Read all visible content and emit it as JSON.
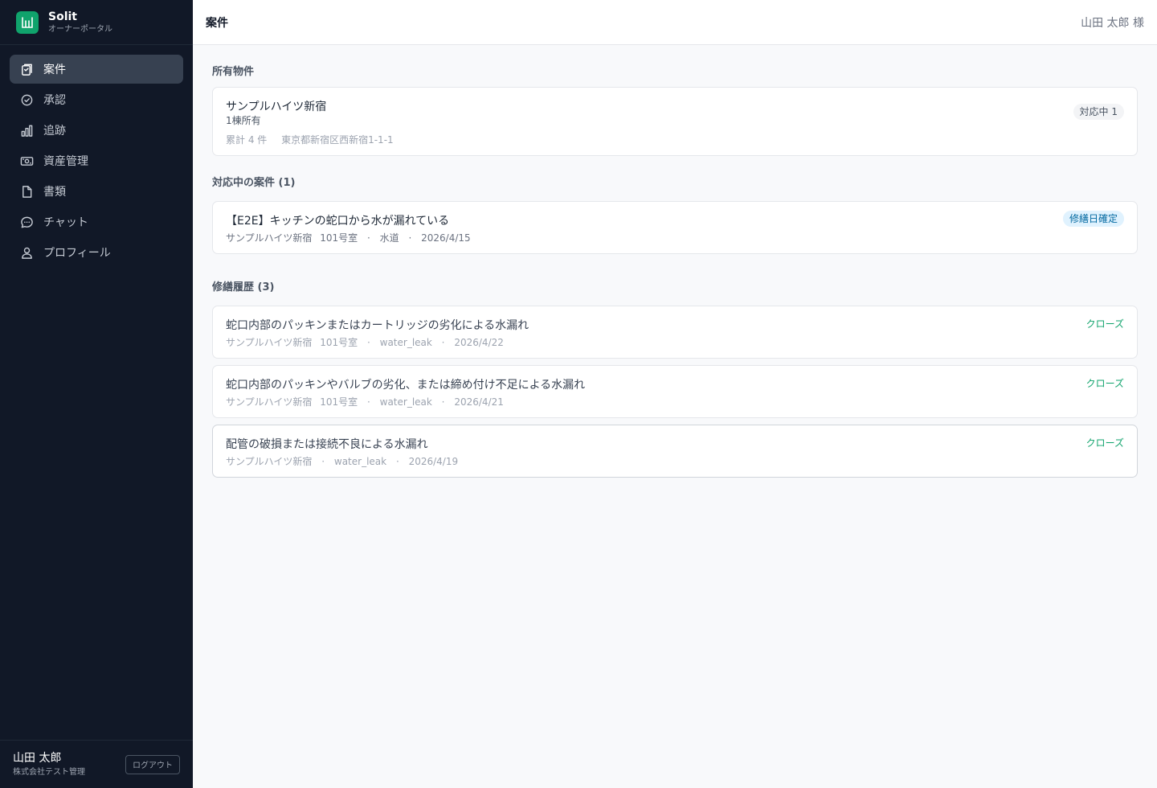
{
  "app": {
    "name": "Solit",
    "subtitle": "オーナーポータル",
    "brand_color": "#10a36c"
  },
  "nav": [
    {
      "label": "案件",
      "icon": "clipboard-icon",
      "active": true
    },
    {
      "label": "承認",
      "icon": "check-circle-icon"
    },
    {
      "label": "追跡",
      "icon": "bar-chart-icon"
    },
    {
      "label": "資産管理",
      "icon": "banknote-icon"
    },
    {
      "label": "書類",
      "icon": "file-icon"
    },
    {
      "label": "チャット",
      "icon": "chat-icon"
    },
    {
      "label": "プロフィール",
      "icon": "user-icon"
    }
  ],
  "user": {
    "name": "山田 太郎",
    "company": "株式会社テスト管理",
    "logout_label": "ログアウト"
  },
  "header": {
    "title": "案件",
    "user_greeting": "山田 太郎 様"
  },
  "properties": {
    "title": "所有物件",
    "items": [
      {
        "name": "サンプルハイツ新宿",
        "ownership": "1棟所有",
        "total": "累計 4 件",
        "address": "東京都新宿区西新宿1-1-1",
        "badge": "対応中 1"
      }
    ]
  },
  "active_cases": {
    "title": "対応中の案件 (1)",
    "items": [
      {
        "title": "【E2E】キッチンの蛇口から水が漏れている",
        "property": "サンプルハイツ新宿",
        "room": "101号室",
        "category": "水道",
        "date": "2026/4/15",
        "status": "修繕日確定"
      }
    ]
  },
  "history": {
    "title": "修繕履歴 (3)",
    "items": [
      {
        "title": "蛇口内部のパッキンまたはカートリッジの劣化による水漏れ",
        "property": "サンプルハイツ新宿",
        "room": "101号室",
        "category": "water_leak",
        "date": "2026/4/22",
        "status": "クローズ"
      },
      {
        "title": "蛇口内部のパッキンやバルブの劣化、または締め付け不足による水漏れ",
        "property": "サンプルハイツ新宿",
        "room": "101号室",
        "category": "water_leak",
        "date": "2026/4/21",
        "status": "クローズ"
      },
      {
        "title": "配管の破損または接続不良による水漏れ",
        "property": "サンプルハイツ新宿",
        "category": "water_leak",
        "date": "2026/4/19",
        "status": "クローズ"
      }
    ]
  }
}
